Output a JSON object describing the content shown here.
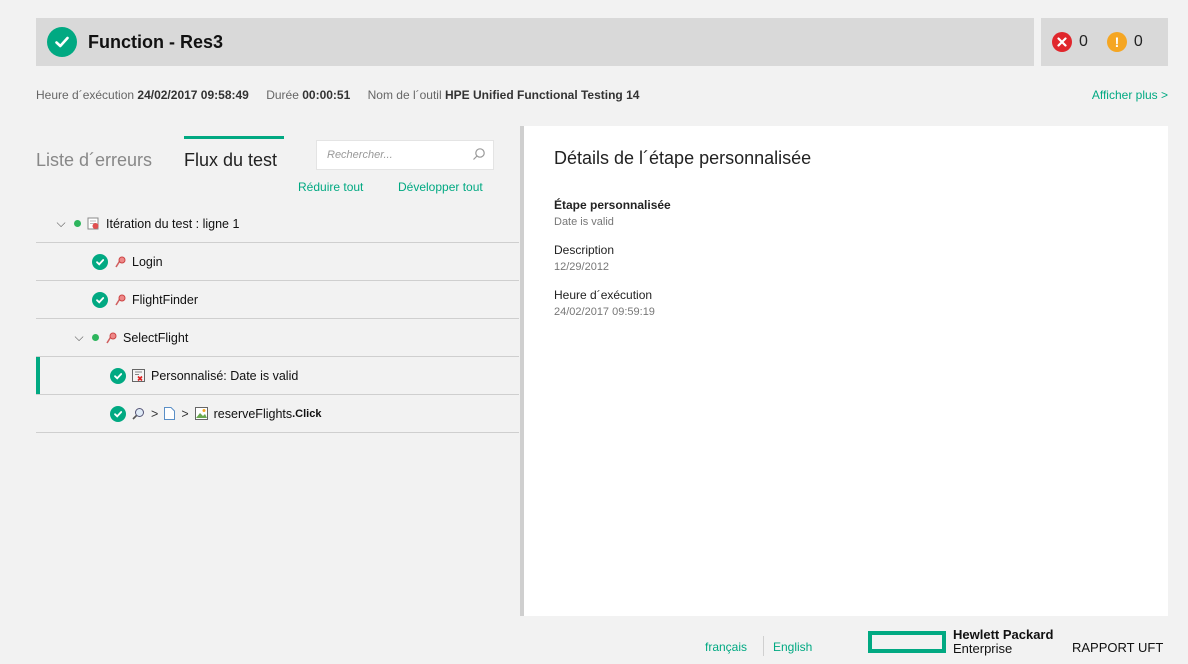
{
  "header": {
    "title": "Function - Res3",
    "errors": "0",
    "warnings": "0"
  },
  "info": {
    "exec_label": "Heure d´exécution",
    "exec_value": "24/02/2017 09:58:49",
    "duration_label": "Durée",
    "duration_value": "00:00:51",
    "tool_label": "Nom de l´outil",
    "tool_value": "HPE Unified Functional Testing 14",
    "more_link": "Afficher plus >"
  },
  "tabs": {
    "errors_tab": "Liste d´erreurs",
    "flow_tab": "Flux du test"
  },
  "search": {
    "placeholder": "Rechercher..."
  },
  "tree_actions": {
    "collapse": "Réduire tout",
    "expand": "Développer tout"
  },
  "tree": {
    "iteration": "Itération du test : ligne 1",
    "login": "Login",
    "flightfinder": "FlightFinder",
    "selectflight": "SelectFlight",
    "custom_step": "Personnalisé: Date is valid",
    "reserve_name": "reserveFlights",
    "reserve_action": ".Click"
  },
  "details": {
    "title": "Détails de l´étape personnalisée",
    "step_label": "Étape personnalisée",
    "step_value": "Date is valid",
    "desc_label": "Description",
    "desc_value": "12/29/2012",
    "time_label": "Heure d´exécution",
    "time_value": "24/02/2017 09:59:19"
  },
  "footer": {
    "lang_fr": "français",
    "lang_en": "English",
    "brand_line1": "Hewlett Packard",
    "brand_line2": "Enterprise",
    "report": "RAPPORT UFT"
  },
  "colors": {
    "accent": "#01a982",
    "error": "#e0262c",
    "warning": "#f5a623"
  }
}
